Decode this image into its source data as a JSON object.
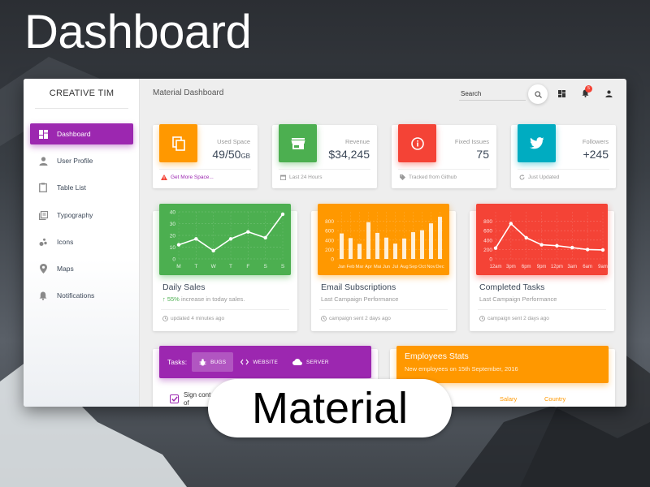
{
  "hero_title": "Dashboard",
  "pill_label": "Material",
  "colors": {
    "purple": "#9c27b0",
    "orange": "#ff9800",
    "green": "#4caf50",
    "red": "#f44336",
    "cyan": "#00acc1"
  },
  "sidebar": {
    "brand": "CREATIVE TIM",
    "items": [
      {
        "label": "Dashboard",
        "icon": "dashboard-icon",
        "active": true
      },
      {
        "label": "User Profile",
        "icon": "person-icon",
        "active": false
      },
      {
        "label": "Table List",
        "icon": "clipboard-icon",
        "active": false
      },
      {
        "label": "Typography",
        "icon": "library-books-icon",
        "active": false
      },
      {
        "label": "Icons",
        "icon": "bubble-chart-icon",
        "active": false
      },
      {
        "label": "Maps",
        "icon": "location-pin-icon",
        "active": false
      },
      {
        "label": "Notifications",
        "icon": "bell-icon",
        "active": false
      }
    ]
  },
  "header": {
    "title": "Material Dashboard",
    "search_placeholder": "Search",
    "notification_count": "5"
  },
  "stats": [
    {
      "label": "Used Space",
      "value": "49/50",
      "unit": "GB",
      "footer": "Get More Space...",
      "icon": "content-copy-icon",
      "footer_icon": "warning-icon",
      "color": "#ff9800"
    },
    {
      "label": "Revenue",
      "value": "$34,245",
      "unit": "",
      "footer": "Last 24 Hours",
      "icon": "store-icon",
      "footer_icon": "calendar-icon",
      "color": "#4caf50"
    },
    {
      "label": "Fixed Issues",
      "value": "75",
      "unit": "",
      "footer": "Tracked from Github",
      "icon": "info-icon",
      "footer_icon": "tag-icon",
      "color": "#f44336"
    },
    {
      "label": "Followers",
      "value": "+245",
      "unit": "",
      "footer": "Just Updated",
      "icon": "twitter-icon",
      "footer_icon": "refresh-icon",
      "color": "#00acc1"
    }
  ],
  "charts": {
    "daily_sales": {
      "title": "Daily Sales",
      "pct": "55%",
      "subtitle_rest": " increase in today sales.",
      "footer": "updated 4 minutes ago"
    },
    "email": {
      "title": "Email Subscriptions",
      "subtitle": "Last Campaign Performance",
      "footer": "campaign sent 2 days ago"
    },
    "tasks": {
      "title": "Completed Tasks",
      "subtitle": "Last Campaign Performance",
      "footer": "campaign sent 2 days ago"
    }
  },
  "chart_data": [
    {
      "type": "line",
      "categories": [
        "M",
        "T",
        "W",
        "T",
        "F",
        "S",
        "S"
      ],
      "values": [
        12,
        17,
        7,
        17,
        23,
        18,
        38
      ],
      "ylim": [
        0,
        40
      ],
      "yticks": [
        0,
        10,
        20,
        30,
        40
      ],
      "color": "#4caf50",
      "grid": true
    },
    {
      "type": "bar",
      "categories": [
        "Jan",
        "Feb",
        "Mar",
        "Apr",
        "Mai",
        "Jun",
        "Jul",
        "Aug",
        "Sep",
        "Oct",
        "Nov",
        "Dec"
      ],
      "values": [
        542,
        443,
        320,
        780,
        553,
        453,
        326,
        434,
        568,
        610,
        756,
        895
      ],
      "ylim": [
        0,
        1000
      ],
      "yticks": [
        0,
        200,
        400,
        600,
        800
      ],
      "color": "#ff9800",
      "grid": true
    },
    {
      "type": "line",
      "categories": [
        "12am",
        "3pm",
        "6pm",
        "9pm",
        "12pm",
        "3am",
        "6am",
        "9am"
      ],
      "values": [
        230,
        750,
        450,
        300,
        280,
        240,
        200,
        190
      ],
      "ylim": [
        0,
        1000
      ],
      "yticks": [
        0,
        200,
        400,
        600,
        800
      ],
      "color": "#f44336",
      "grid": true
    }
  ],
  "tasks_panel": {
    "label": "Tasks:",
    "tabs": [
      {
        "label": "BUGS",
        "icon": "bug-icon",
        "active": true
      },
      {
        "label": "WEBSITE",
        "icon": "code-icon",
        "active": false
      },
      {
        "label": "SERVER",
        "icon": "cloud-icon",
        "active": false
      }
    ],
    "first_task": "Sign cont afraid of"
  },
  "employees": {
    "title": "Employees Stats",
    "subtitle": "New employees on 15th September, 2016",
    "columns": [
      "Salary",
      "Country"
    ]
  }
}
